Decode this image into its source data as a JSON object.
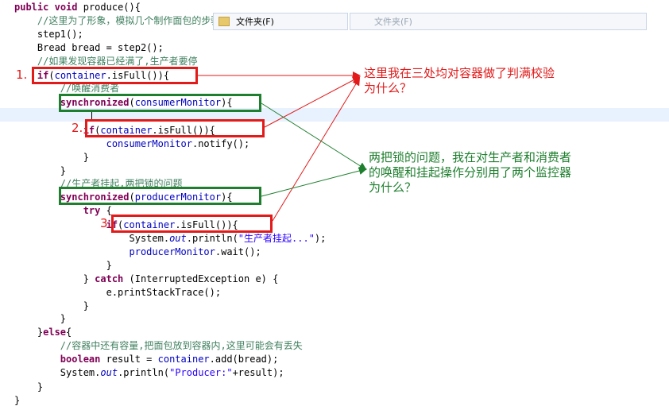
{
  "menu_popups": [
    {
      "label": "文件夹(F)",
      "active": true
    },
    {
      "label": "文件夹(F)",
      "active": false
    }
  ],
  "code_lines": [
    [
      {
        "t": "public void produce(){",
        "c": "kw-mixed"
      }
    ],
    [
      {
        "t": "    //这里为了形象，模拟几个制作面包的步骤",
        "c": "cm"
      }
    ],
    [
      {
        "t": "    step1();",
        "c": ""
      }
    ],
    [
      {
        "t": "    Bread bread = step2();",
        "c": ""
      }
    ],
    [
      {
        "t": "    //如果发现容器已经满了,生产者要停",
        "c": "cm"
      }
    ],
    [
      {
        "t": "    ",
        "c": ""
      },
      {
        "t": "if",
        "c": "kw"
      },
      {
        "t": "(",
        "c": ""
      },
      {
        "t": "container",
        "c": "fld"
      },
      {
        "t": ".isFull()){",
        "c": ""
      }
    ],
    [
      {
        "t": "        //唤醒消费者",
        "c": "cm"
      }
    ],
    [
      {
        "t": "        ",
        "c": ""
      },
      {
        "t": "synchronized",
        "c": "kw"
      },
      {
        "t": "(",
        "c": ""
      },
      {
        "t": "consumerMonitor",
        "c": "fld"
      },
      {
        "t": "){",
        "c": ""
      }
    ],
    [
      {
        "t": "",
        "c": ""
      }
    ],
    [
      {
        "t": "            ",
        "c": ""
      },
      {
        "t": "if",
        "c": "kw"
      },
      {
        "t": "(",
        "c": ""
      },
      {
        "t": "container",
        "c": "fld"
      },
      {
        "t": ".isFull()){",
        "c": ""
      }
    ],
    [
      {
        "t": "                ",
        "c": ""
      },
      {
        "t": "consumerMonitor",
        "c": "fld"
      },
      {
        "t": ".notify();",
        "c": ""
      }
    ],
    [
      {
        "t": "            }",
        "c": ""
      }
    ],
    [
      {
        "t": "        }",
        "c": ""
      }
    ],
    [
      {
        "t": "        //生产者挂起,两把锁的问题",
        "c": "cm"
      }
    ],
    [
      {
        "t": "        ",
        "c": ""
      },
      {
        "t": "synchronized",
        "c": "kw"
      },
      {
        "t": "(",
        "c": ""
      },
      {
        "t": "producerMonitor",
        "c": "fld"
      },
      {
        "t": "){",
        "c": ""
      }
    ],
    [
      {
        "t": "            ",
        "c": ""
      },
      {
        "t": "try",
        "c": "kw"
      },
      {
        "t": " {",
        "c": ""
      }
    ],
    [
      {
        "t": "                ",
        "c": ""
      },
      {
        "t": "if",
        "c": "kw"
      },
      {
        "t": "(",
        "c": ""
      },
      {
        "t": "container",
        "c": "fld"
      },
      {
        "t": ".isFull()){",
        "c": ""
      }
    ],
    [
      {
        "t": "                    System.",
        "c": ""
      },
      {
        "t": "out",
        "c": "it"
      },
      {
        "t": ".println(",
        "c": ""
      },
      {
        "t": "\"生产者挂起...\"",
        "c": "st"
      },
      {
        "t": ");",
        "c": ""
      }
    ],
    [
      {
        "t": "                    ",
        "c": ""
      },
      {
        "t": "producerMonitor",
        "c": "fld"
      },
      {
        "t": ".wait();",
        "c": ""
      }
    ],
    [
      {
        "t": "                }",
        "c": ""
      }
    ],
    [
      {
        "t": "            } ",
        "c": ""
      },
      {
        "t": "catch",
        "c": "kw"
      },
      {
        "t": " (InterruptedException e) {",
        "c": ""
      }
    ],
    [
      {
        "t": "                e.printStackTrace();",
        "c": ""
      }
    ],
    [
      {
        "t": "            }",
        "c": ""
      }
    ],
    [
      {
        "t": "        }",
        "c": ""
      }
    ],
    [
      {
        "t": "    }",
        "c": ""
      },
      {
        "t": "else",
        "c": "kw"
      },
      {
        "t": "{",
        "c": ""
      }
    ],
    [
      {
        "t": "        //容器中还有容量,把面包放到容器内,这里可能会有丢失",
        "c": "cm"
      }
    ],
    [
      {
        "t": "        ",
        "c": ""
      },
      {
        "t": "boolean",
        "c": "kw"
      },
      {
        "t": " result = ",
        "c": ""
      },
      {
        "t": "container",
        "c": "fld"
      },
      {
        "t": ".add(bread);",
        "c": ""
      }
    ],
    [
      {
        "t": "        System.",
        "c": ""
      },
      {
        "t": "out",
        "c": "it"
      },
      {
        "t": ".println(",
        "c": ""
      },
      {
        "t": "\"Producer:\"",
        "c": "st"
      },
      {
        "t": "+result);",
        "c": ""
      }
    ],
    [
      {
        "t": "    }",
        "c": ""
      }
    ],
    [
      {
        "t": "}",
        "c": ""
      }
    ]
  ],
  "markers": {
    "one": "1.",
    "two": "2.",
    "three": "3."
  },
  "notes": {
    "red": "这里我在三处均对容器做了判满校验\n为什么？",
    "green": "两把锁的问题，我在对生产者和消费者\n的唤醒和挂起操作分别用了两个监控器\n为什么？"
  },
  "colors": {
    "red": "#e21a1a",
    "green": "#1e7f2e",
    "keyword": "#7f0055",
    "comment": "#3f7f5f",
    "string": "#2a00ff",
    "field": "#0000c0"
  }
}
